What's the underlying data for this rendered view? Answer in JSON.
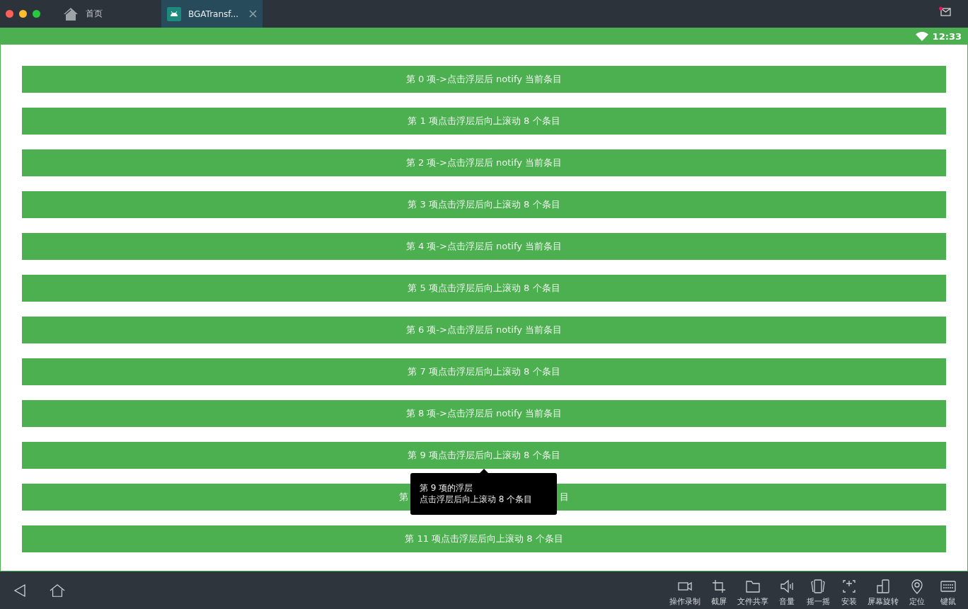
{
  "tabs": [
    {
      "label": "首页",
      "kind": "home",
      "selected": false
    },
    {
      "label": "BGATransf...",
      "kind": "app",
      "selected": true
    }
  ],
  "status_bar": {
    "time": "12:33"
  },
  "rows": [
    {
      "kind": "full",
      "text": "第 0 项->点击浮层后 notify 当前条目"
    },
    {
      "kind": "full",
      "text": "第 1 项点击浮层后向上滚动 8 个条目"
    },
    {
      "kind": "full",
      "text": "第 2 项->点击浮层后 notify 当前条目"
    },
    {
      "kind": "full",
      "text": "第 3 项点击浮层后向上滚动 8 个条目"
    },
    {
      "kind": "full",
      "text": "第 4 项->点击浮层后 notify 当前条目"
    },
    {
      "kind": "full",
      "text": "第 5 项点击浮层后向上滚动 8 个条目"
    },
    {
      "kind": "full",
      "text": "第 6 项->点击浮层后 notify 当前条目"
    },
    {
      "kind": "full",
      "text": "第 7 项点击浮层后向上滚动 8 个条目"
    },
    {
      "kind": "full",
      "text": "第 8 项->点击浮层后 notify 当前条目"
    },
    {
      "kind": "full",
      "text": "第 9 项点击浮层后向上滚动 8 个条目"
    },
    {
      "kind": "covered",
      "text_start": "第",
      "text_end": "目"
    },
    {
      "kind": "full",
      "text": "第 11 项点击浮层后向上滚动 8 个条目"
    }
  ],
  "tooltip": {
    "lines": [
      "第 9 项的浮层",
      "点击浮层后向上滚动 8 个条目"
    ]
  },
  "toolbar": [
    {
      "kind": "record",
      "label": "操作录制"
    },
    {
      "kind": "crop",
      "label": "截屏"
    },
    {
      "kind": "folder",
      "label": "文件共享"
    },
    {
      "kind": "volume",
      "label": "音量"
    },
    {
      "kind": "shake",
      "label": "摇一摇"
    },
    {
      "kind": "install",
      "label": "安装"
    },
    {
      "kind": "rotate",
      "label": "屏幕旋转"
    },
    {
      "kind": "location",
      "label": "定位"
    },
    {
      "kind": "keyboard",
      "label": "键鼠"
    }
  ]
}
